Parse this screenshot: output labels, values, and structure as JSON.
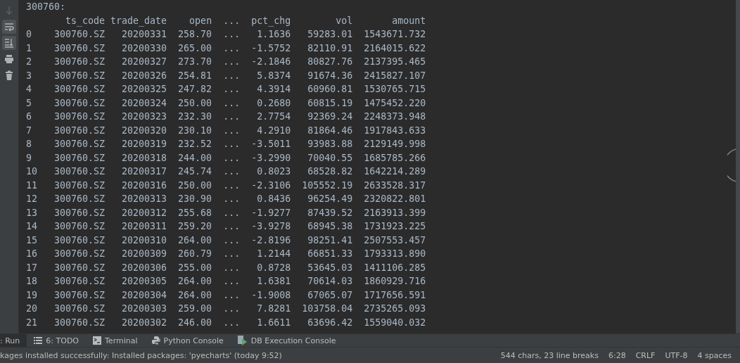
{
  "toolbar": [
    {
      "kind": "down",
      "selected": false,
      "disabled": true
    },
    {
      "kind": "wrap",
      "selected": true,
      "disabled": false
    },
    {
      "kind": "scroll",
      "selected": true,
      "disabled": false
    },
    {
      "kind": "print",
      "selected": false,
      "disabled": false
    },
    {
      "kind": "trash",
      "selected": false,
      "disabled": false
    }
  ],
  "output": {
    "title": "300760:",
    "columns": [
      "",
      "ts_code",
      "trade_date",
      "open",
      "...",
      "pct_chg",
      "vol",
      "amount"
    ],
    "rows": [
      [
        "0",
        "300760.SZ",
        "20200331",
        "258.70",
        "...",
        "1.1636",
        "59283.01",
        "1543671.732"
      ],
      [
        "1",
        "300760.SZ",
        "20200330",
        "265.00",
        "...",
        "-1.5752",
        "82110.91",
        "2164015.622"
      ],
      [
        "2",
        "300760.SZ",
        "20200327",
        "273.70",
        "...",
        "-2.1846",
        "80827.76",
        "2137395.465"
      ],
      [
        "3",
        "300760.SZ",
        "20200326",
        "254.81",
        "...",
        "5.8374",
        "91674.36",
        "2415827.107"
      ],
      [
        "4",
        "300760.SZ",
        "20200325",
        "247.82",
        "...",
        "4.3914",
        "60960.81",
        "1530765.715"
      ],
      [
        "5",
        "300760.SZ",
        "20200324",
        "250.00",
        "...",
        "0.2680",
        "60815.19",
        "1475452.220"
      ],
      [
        "6",
        "300760.SZ",
        "20200323",
        "232.30",
        "...",
        "2.7754",
        "92369.24",
        "2248373.948"
      ],
      [
        "7",
        "300760.SZ",
        "20200320",
        "230.10",
        "...",
        "4.2910",
        "81864.46",
        "1917843.633"
      ],
      [
        "8",
        "300760.SZ",
        "20200319",
        "232.52",
        "...",
        "-3.5011",
        "93983.88",
        "2129149.998"
      ],
      [
        "9",
        "300760.SZ",
        "20200318",
        "244.00",
        "...",
        "-3.2990",
        "70040.55",
        "1685785.266"
      ],
      [
        "10",
        "300760.SZ",
        "20200317",
        "245.74",
        "...",
        "0.8023",
        "68528.82",
        "1642214.289"
      ],
      [
        "11",
        "300760.SZ",
        "20200316",
        "250.00",
        "...",
        "-2.3106",
        "105552.19",
        "2633528.317"
      ],
      [
        "12",
        "300760.SZ",
        "20200313",
        "230.90",
        "...",
        "0.8436",
        "96254.49",
        "2320822.801"
      ],
      [
        "13",
        "300760.SZ",
        "20200312",
        "255.68",
        "...",
        "-1.9277",
        "87439.52",
        "2163913.399"
      ],
      [
        "14",
        "300760.SZ",
        "20200311",
        "259.20",
        "...",
        "-3.9278",
        "68945.38",
        "1731923.225"
      ],
      [
        "15",
        "300760.SZ",
        "20200310",
        "264.00",
        "...",
        "-2.8196",
        "98251.41",
        "2507553.457"
      ],
      [
        "16",
        "300760.SZ",
        "20200309",
        "260.79",
        "...",
        "1.2144",
        "66851.33",
        "1793313.890"
      ],
      [
        "17",
        "300760.SZ",
        "20200306",
        "255.00",
        "...",
        "0.8728",
        "53645.03",
        "1411106.285"
      ],
      [
        "18",
        "300760.SZ",
        "20200305",
        "264.00",
        "...",
        "1.6381",
        "70614.03",
        "1860929.716"
      ],
      [
        "19",
        "300760.SZ",
        "20200304",
        "264.00",
        "...",
        "-1.9008",
        "67065.07",
        "1717656.591"
      ],
      [
        "20",
        "300760.SZ",
        "20200303",
        "259.00",
        "...",
        "7.8281",
        "103758.04",
        "2735265.093"
      ],
      [
        "21",
        "300760.SZ",
        "20200302",
        "246.00",
        "...",
        "1.6611",
        "63696.42",
        "1559040.032"
      ]
    ]
  },
  "tabs": [
    {
      "label": ": Run",
      "kind": "run",
      "selected": true
    },
    {
      "label": "6: TODO",
      "kind": "todo",
      "selected": false
    },
    {
      "label": "Terminal",
      "kind": "terminal",
      "selected": false
    },
    {
      "label": "Python Console",
      "kind": "python",
      "selected": false
    },
    {
      "label": "DB Execution Console",
      "kind": "db",
      "selected": false
    }
  ],
  "status_bar": {
    "message": "kages installed successfully: Installed packages: 'pyecharts' (today 9:52)",
    "items": [
      "544 chars, 23 line breaks",
      "6:28",
      "CRLF",
      "UTF-8",
      "4 spaces"
    ]
  }
}
